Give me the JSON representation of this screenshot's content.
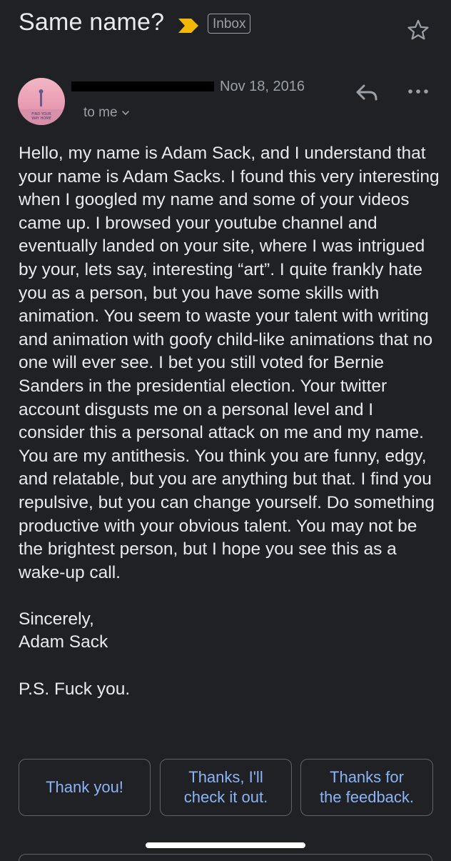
{
  "email": {
    "subject": "Same name?",
    "label": "Inbox",
    "date": "Nov 18, 2016",
    "recipient": "to me"
  },
  "avatar": {
    "caption_line1": "FIND YOUR",
    "caption_line2": "WAY HOME"
  },
  "body": {
    "paragraphs": [
      "Hello, my name is Adam Sack, and I understand that your name is Adam Sacks. I found this very interesting when I googled my name and some of your videos came up. I browsed your youtube channel and eventually landed on your site, where I was intrigued by your, lets say, interesting “art”. I quite frankly hate you as a person, but you have some skills with animation. You seem to waste your talent with writing and animation with goofy child-like animations that no one will ever see. I bet you still voted for Bernie Sanders in the presidential election. Your twitter account disgusts me on a personal level and I consider this a personal attack on me and my name. You are my antithesis. You think you are funny, edgy, and relatable, but you are anything but that. I find you repulsive, but you can change yourself. Do something productive with your obvious talent. You may not be the brightest person, but I hope you see this as a wake-up call.",
      "Sincerely,\nAdam Sack",
      "P.S. Fuck you."
    ]
  },
  "smart_replies": [
    "Thank you!",
    "Thanks, I'll\ncheck it out.",
    "Thanks for\nthe feedback."
  ],
  "colors": {
    "background": "#202124",
    "text": "#e8eaed",
    "secondary_text": "#9aa0a6",
    "accent_link": "#8ab4f8",
    "importance_marker": "#f5b800"
  },
  "icons": {
    "importance": "importance-marker-icon",
    "star": "star-icon",
    "reply": "reply-icon",
    "more": "more-horizontal-icon",
    "chevron": "chevron-down-icon"
  }
}
